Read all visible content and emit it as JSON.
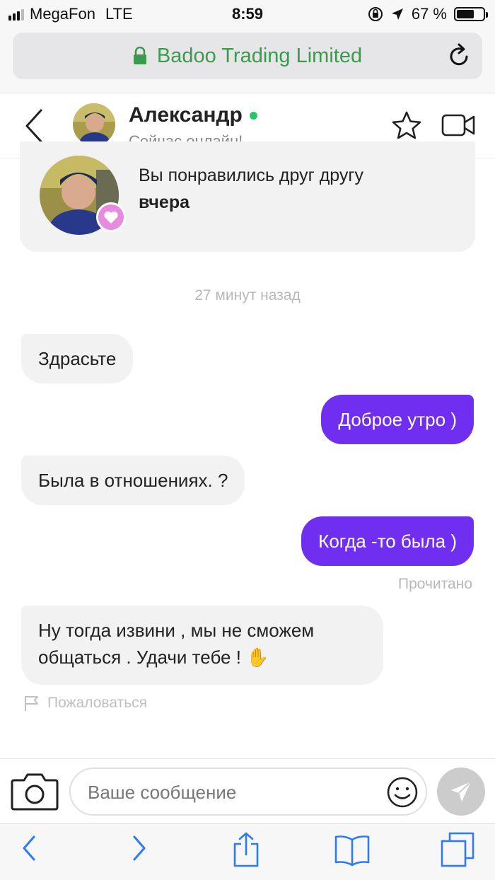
{
  "status_bar": {
    "carrier": "MegaFon",
    "network": "LTE",
    "time": "8:59",
    "battery_percent": "67 %",
    "battery_level": 0.67
  },
  "browser": {
    "domain": "Badoo Trading Limited",
    "secure": true,
    "accent_color": "#3a9b4a"
  },
  "chat_header": {
    "name": "Александр",
    "status": "Сейчас онлайн!",
    "online_color": "#28c46a"
  },
  "match_card": {
    "text": "Вы понравились друг другу",
    "when": "вчера"
  },
  "timestamp": "27 минут назад",
  "messages": [
    {
      "from": "them",
      "text": "Здрасьте"
    },
    {
      "from": "me",
      "text": "Доброе утро )"
    },
    {
      "from": "them",
      "text": "Была в отношениях. ?"
    },
    {
      "from": "me",
      "text": "Когда -то была )"
    },
    {
      "from": "them",
      "text": "Ну тогда извини , мы не сможем общаться . Удачи тебе ! ✋"
    }
  ],
  "read_receipt": "Прочитано",
  "report_label": "Пожаловаться",
  "composer": {
    "placeholder": "Ваше сообщение"
  },
  "colors": {
    "outgoing_bubble": "#6f2ef0",
    "incoming_bubble": "#f2f2f3",
    "heart_badge": "#e88ae0",
    "ios_blue": "#2f7bf5"
  },
  "icons": [
    "signal-icon",
    "location-icon",
    "orientation-lock-icon",
    "battery-icon",
    "lock-icon",
    "reload-icon",
    "back-icon",
    "star-icon",
    "video-icon",
    "heart-icon",
    "flag-icon",
    "camera-icon",
    "emoji-icon",
    "send-icon",
    "browser-back-icon",
    "browser-forward-icon",
    "share-icon",
    "bookmarks-icon",
    "tabs-icon"
  ]
}
